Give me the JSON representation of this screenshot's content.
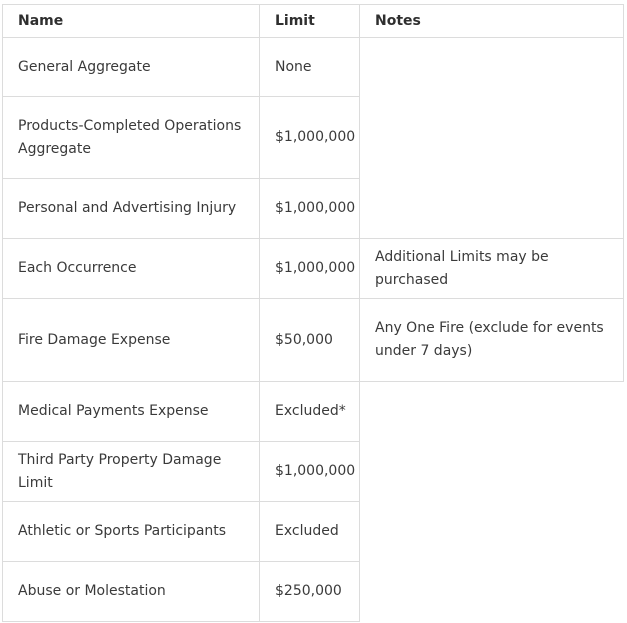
{
  "headers": {
    "name": "Name",
    "limit": "Limit",
    "notes": "Notes"
  },
  "rows": [
    {
      "name": "General Aggregate",
      "limit": "None",
      "notes": ""
    },
    {
      "name": "Products-Completed Operations Aggregate",
      "limit": "$1,000,000",
      "notes": ""
    },
    {
      "name": "Personal and Advertising Injury",
      "limit": "$1,000,000",
      "notes": ""
    },
    {
      "name": "Each Occurrence",
      "limit": "$1,000,000",
      "notes": "Additional Limits may be purchased"
    },
    {
      "name": "Fire Damage Expense",
      "limit": "$50,000",
      "notes": "Any One Fire (exclude for events under 7 days)"
    },
    {
      "name": "Medical Payments Expense",
      "limit": "Excluded*",
      "notes": ""
    },
    {
      "name": "Third Party Property Damage Limit",
      "limit": "$1,000,000",
      "notes": ""
    },
    {
      "name": "Athletic or Sports Participants",
      "limit": "Excluded",
      "notes": ""
    },
    {
      "name": "Abuse or Molestation",
      "limit": "$250,000",
      "notes": ""
    }
  ]
}
